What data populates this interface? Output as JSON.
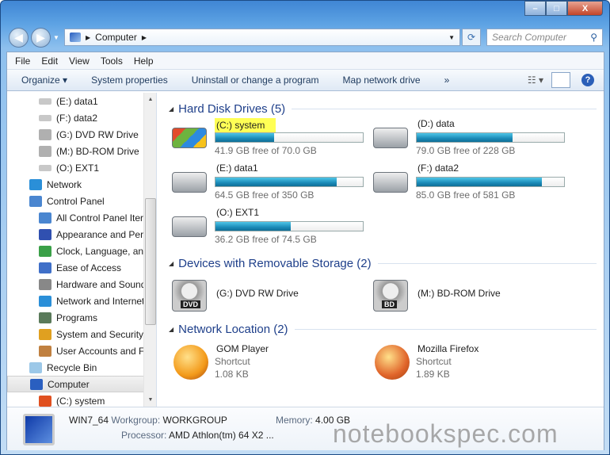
{
  "window": {
    "controls": {
      "minimize": "–",
      "maximize": "□",
      "close": "X"
    }
  },
  "address": {
    "crumbs": [
      "Computer"
    ],
    "search_placeholder": "Search Computer"
  },
  "menu": [
    "File",
    "Edit",
    "View",
    "Tools",
    "Help"
  ],
  "toolbar": {
    "organize": "Organize ▾",
    "items": [
      "System properties",
      "Uninstall or change a program",
      "Map network drive",
      "»"
    ]
  },
  "nav": {
    "items": [
      {
        "label": "(E:) data1",
        "icon": "hdd",
        "indent": 2
      },
      {
        "label": "(F:) data2",
        "icon": "hdd",
        "indent": 2
      },
      {
        "label": "(G:) DVD RW Drive",
        "icon": "dvd",
        "indent": 2
      },
      {
        "label": "(M:) BD-ROM Drive",
        "icon": "dvd",
        "indent": 2
      },
      {
        "label": "(O:) EXT1",
        "icon": "hdd",
        "indent": 2
      },
      {
        "label": "Network",
        "icon": "network",
        "indent": 1
      },
      {
        "label": "Control Panel",
        "icon": "control-panel",
        "indent": 1
      },
      {
        "label": "All Control Panel Iter",
        "icon": "control-panel",
        "indent": 2
      },
      {
        "label": "Appearance and Pers",
        "icon": "appearance",
        "indent": 2
      },
      {
        "label": "Clock, Language, and",
        "icon": "clock",
        "indent": 2
      },
      {
        "label": "Ease of Access",
        "icon": "ease",
        "indent": 2
      },
      {
        "label": "Hardware and Sound",
        "icon": "hardware",
        "indent": 2
      },
      {
        "label": "Network and Internet",
        "icon": "network",
        "indent": 2
      },
      {
        "label": "Programs",
        "icon": "programs",
        "indent": 2
      },
      {
        "label": "System and Security",
        "icon": "security",
        "indent": 2
      },
      {
        "label": "User Accounts and Fa",
        "icon": "users",
        "indent": 2
      },
      {
        "label": "Recycle Bin",
        "icon": "recycle",
        "indent": 1
      },
      {
        "label": "Computer",
        "icon": "computer",
        "indent": 1,
        "selected": true
      },
      {
        "label": "(C:) system",
        "icon": "windows-drive",
        "indent": 2
      }
    ]
  },
  "groups": {
    "hdd": {
      "title": "Hard Disk Drives (5)",
      "drives": [
        {
          "name": "(C:) system",
          "free": "41.9 GB free of 70.0 GB",
          "used_fraction": 0.4,
          "highlight": true
        },
        {
          "name": "(D:) data",
          "free": "79.0 GB free of 228 GB",
          "used_fraction": 0.65
        },
        {
          "name": "(E:) data1",
          "free": "64.5 GB free of 350 GB",
          "used_fraction": 0.82
        },
        {
          "name": "(F:) data2",
          "free": "85.0 GB free of 581 GB",
          "used_fraction": 0.85
        },
        {
          "name": "(O:) EXT1",
          "free": "36.2 GB free of 74.5 GB",
          "used_fraction": 0.51
        }
      ]
    },
    "removable": {
      "title": "Devices with Removable Storage (2)",
      "devices": [
        {
          "name": "(G:) DVD RW Drive",
          "badge": "DVD"
        },
        {
          "name": "(M:) BD-ROM Drive",
          "badge": "BD"
        }
      ]
    },
    "network": {
      "title": "Network Location (2)",
      "items": [
        {
          "name": "GOM Player",
          "type": "Shortcut",
          "size": "1.08 KB",
          "color": "#f39a1a"
        },
        {
          "name": "Mozilla Firefox",
          "type": "Shortcut",
          "size": "1.89 KB",
          "color": "#e0642a"
        }
      ]
    }
  },
  "details": {
    "name": "WIN7_64",
    "workgroup_label": "Workgroup:",
    "workgroup": "WORKGROUP",
    "memory_label": "Memory:",
    "memory": "4.00 GB",
    "processor_label": "Processor:",
    "processor": "AMD Athlon(tm) 64 X2 ..."
  },
  "watermark": "notebookspec.com"
}
